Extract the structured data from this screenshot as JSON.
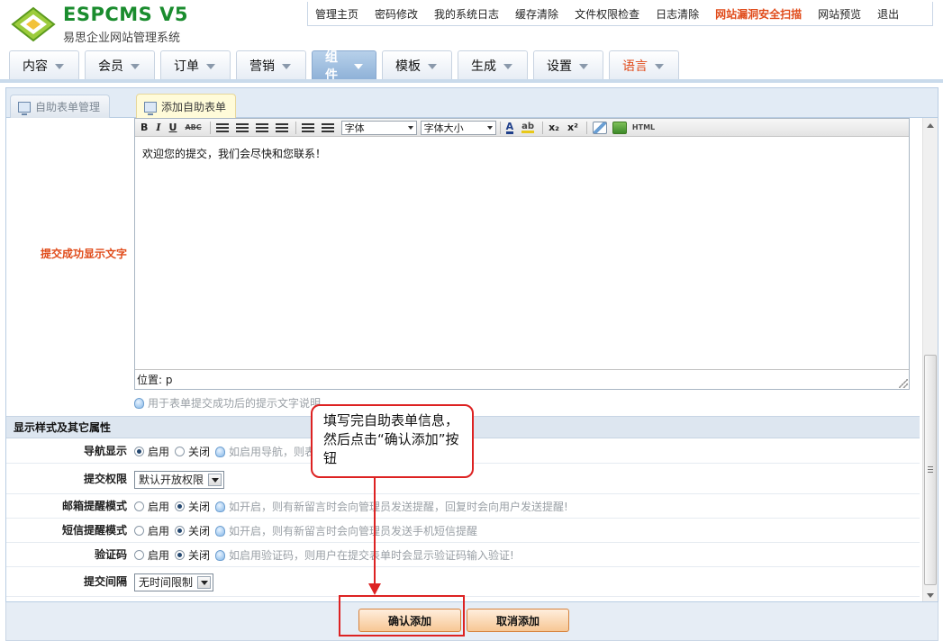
{
  "logo": {
    "brand": "ESPCMS V5",
    "subtitle": "易思企业网站管理系统"
  },
  "top_nav": [
    {
      "label": "管理主页",
      "highlight": false
    },
    {
      "label": "密码修改",
      "highlight": false
    },
    {
      "label": "我的系统日志",
      "highlight": false
    },
    {
      "label": "缓存清除",
      "highlight": false
    },
    {
      "label": "文件权限检查",
      "highlight": false
    },
    {
      "label": "日志清除",
      "highlight": false
    },
    {
      "label": "网站漏洞安全扫描",
      "highlight": true
    },
    {
      "label": "网站预览",
      "highlight": false
    },
    {
      "label": "退出",
      "highlight": false
    }
  ],
  "main_nav": [
    {
      "label": "内容",
      "active": false
    },
    {
      "label": "会员",
      "active": false
    },
    {
      "label": "订单",
      "active": false
    },
    {
      "label": "营销",
      "active": false
    },
    {
      "label": "组件",
      "active": true
    },
    {
      "label": "模板",
      "active": false
    },
    {
      "label": "生成",
      "active": false
    },
    {
      "label": "设置",
      "active": false
    },
    {
      "label": "语言",
      "active": false
    }
  ],
  "sub_tabs": {
    "manage": "自助表单管理",
    "add": "添加自助表单"
  },
  "editor": {
    "field_label": "提交成功显示文字",
    "toolbar": {
      "bold": "B",
      "italic": "I",
      "underline": "U",
      "strike": "ABC",
      "font_select": "字体",
      "size_select": "字体大小",
      "font_color": "A",
      "highlight": "ab",
      "subscript": "x₂",
      "superscript": "x²",
      "html": "HTML"
    },
    "content": "欢迎您的提交，我们会尽快和您联系！",
    "status": "位置: p",
    "hint": "用于表单提交成功后的提示文字说明"
  },
  "section": {
    "title": "显示样式及其它属性"
  },
  "options": {
    "on": "启用",
    "off": "关闭",
    "nav": {
      "label": "导航显示",
      "value": "on",
      "hint": "如启用导航，则表"
    },
    "permission": {
      "label": "提交权限",
      "value": "默认开放权限"
    },
    "email": {
      "label": "邮箱提醒模式",
      "value": "off",
      "hint": "如开启，则有新留言时会向管理员发送提醒，回复时会向用户发送提醒!"
    },
    "sms": {
      "label": "短信提醒模式",
      "value": "off",
      "hint": "如开启，则有新留言时会向管理员发送手机短信提醒"
    },
    "captcha": {
      "label": "验证码",
      "value": "off",
      "hint": "如启用验证码，则用户在提交表单时会显示验证码输入验证!"
    },
    "interval": {
      "label": "提交间隔",
      "value": "无时间限制"
    }
  },
  "buttons": {
    "confirm": "确认添加",
    "cancel": "取消添加"
  },
  "callout": {
    "text": "填写完自助表单信息，然后点击“确认添加”按钮"
  },
  "colors": {
    "accent": "#e04b1a",
    "annotation": "#dd2222",
    "brand": "#1a8c2e",
    "active_tab": "#8fb2d8"
  }
}
